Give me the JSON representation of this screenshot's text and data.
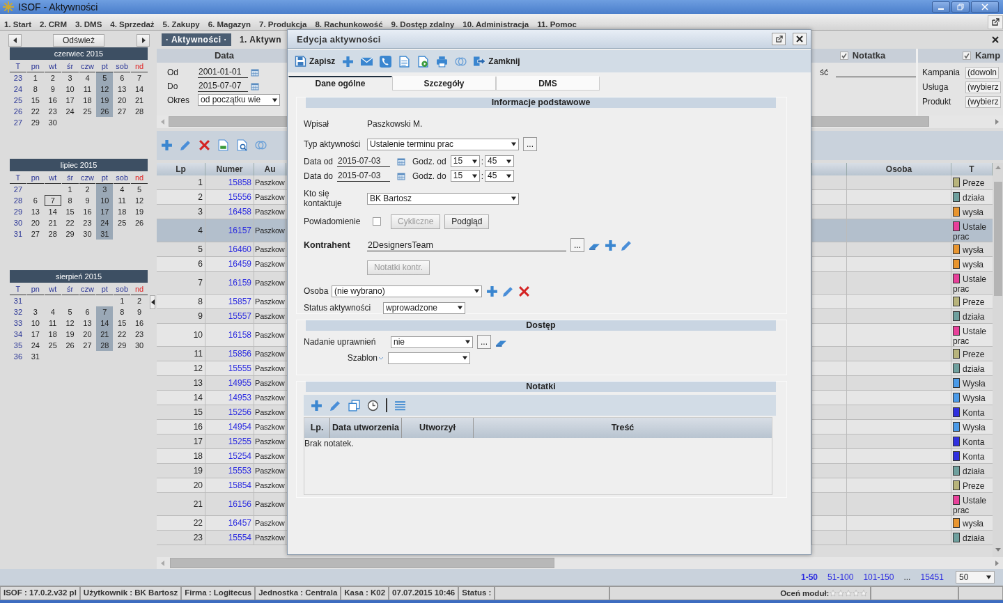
{
  "window": {
    "title": "ISOF - Aktywności"
  },
  "menu": [
    "1. Start",
    "2. CRM",
    "3. DMS",
    "4. Sprzedaż",
    "5. Zakupy",
    "6. Magazyn",
    "7. Produkcja",
    "8. Rachunkowość",
    "9. Dostęp zdalny",
    "10. Administracja",
    "11. Pomoc"
  ],
  "left_panel": {
    "refresh_button": "Odśwież",
    "calendars": [
      {
        "title": "czerwiec 2015",
        "headers": [
          {
            "label": "T",
            "kind": "week",
            "marked": false
          },
          {
            "label": "pn",
            "kind": "day",
            "marked": false
          },
          {
            "label": "wt",
            "kind": "day",
            "marked": false
          },
          {
            "label": "śr",
            "kind": "day",
            "marked": false
          },
          {
            "label": "czw",
            "kind": "day",
            "marked": false
          },
          {
            "label": "pt",
            "kind": "day",
            "marked": true
          },
          {
            "label": "sob",
            "kind": "day",
            "marked": false
          },
          {
            "label": "nd",
            "kind": "holiday",
            "marked": false
          }
        ],
        "weeks": [
          {
            "week": "23",
            "days": [
              "1",
              "2",
              "3",
              "4",
              "5",
              "6",
              "7"
            ]
          },
          {
            "week": "24",
            "days": [
              "8",
              "9",
              "10",
              "11",
              "12",
              "13",
              "14"
            ]
          },
          {
            "week": "25",
            "days": [
              "15",
              "16",
              "17",
              "18",
              "19",
              "20",
              "21"
            ]
          },
          {
            "week": "26",
            "days": [
              "22",
              "23",
              "24",
              "25",
              "26",
              "27",
              "28"
            ]
          },
          {
            "week": "27",
            "days": [
              "29",
              "30"
            ]
          }
        ]
      },
      {
        "title": "lipiec 2015",
        "headers": [
          {
            "label": "T",
            "kind": "week",
            "marked": false
          },
          {
            "label": "pn",
            "kind": "day",
            "marked": false
          },
          {
            "label": "wt",
            "kind": "day",
            "marked": false
          },
          {
            "label": "śr",
            "kind": "day",
            "marked": false
          },
          {
            "label": "czw",
            "kind": "day",
            "marked": false
          },
          {
            "label": "pt",
            "kind": "day",
            "marked": true
          },
          {
            "label": "sob",
            "kind": "day",
            "marked": false
          },
          {
            "label": "nd",
            "kind": "holiday",
            "marked": false
          }
        ],
        "weeks": [
          {
            "week": "27",
            "days": [
              "1",
              "2",
              "3",
              "4",
              "5"
            ]
          },
          {
            "week": "28",
            "days": [
              "6",
              {
                "day": "7",
                "today": true
              },
              "8",
              "9",
              "10",
              "11",
              "12"
            ]
          },
          {
            "week": "29",
            "days": [
              "13",
              "14",
              "15",
              "16",
              "17",
              "18",
              "19"
            ]
          },
          {
            "week": "30",
            "days": [
              "20",
              "21",
              "22",
              "23",
              "24",
              "25",
              "26"
            ]
          },
          {
            "week": "31",
            "days": [
              "27",
              "28",
              "29",
              "30",
              "31"
            ]
          }
        ]
      },
      {
        "title": "sierpień 2015",
        "headers": [
          {
            "label": "T",
            "kind": "week",
            "marked": false
          },
          {
            "label": "pn",
            "kind": "day",
            "marked": false
          },
          {
            "label": "wt",
            "kind": "day",
            "marked": false
          },
          {
            "label": "śr",
            "kind": "day",
            "marked": false
          },
          {
            "label": "czw",
            "kind": "day",
            "marked": false
          },
          {
            "label": "pt",
            "kind": "day",
            "marked": true
          },
          {
            "label": "sob",
            "kind": "day",
            "marked": false
          },
          {
            "label": "nd",
            "kind": "holiday",
            "marked": false
          }
        ],
        "weeks": [
          {
            "week": "31",
            "days": [
              "1",
              "2"
            ]
          },
          {
            "week": "32",
            "days": [
              "3",
              "4",
              "5",
              "6",
              "7",
              "8",
              "9"
            ]
          },
          {
            "week": "33",
            "days": [
              "10",
              "11",
              "12",
              "13",
              "14",
              "15",
              "16"
            ]
          },
          {
            "week": "34",
            "days": [
              "17",
              "18",
              "19",
              "20",
              "21",
              "22",
              "23"
            ]
          },
          {
            "week": "35",
            "days": [
              "24",
              "25",
              "26",
              "27",
              "28",
              "29",
              "30"
            ]
          },
          {
            "week": "36",
            "days": [
              "31"
            ]
          }
        ]
      }
    ]
  },
  "tabs": [
    {
      "label": "· Aktywności ·",
      "selected": true
    },
    {
      "label": "1. Aktywn",
      "selected": false
    }
  ],
  "filters": {
    "data": {
      "title": "Data",
      "from_label": "Od",
      "from": "2001-01-01",
      "to_label": "Do",
      "to": "2015-07-07",
      "period_label": "Okres",
      "period": "od początku wie"
    },
    "notatka": {
      "title": "Notatka",
      "checked": true,
      "field_label": "ść"
    },
    "kampania": {
      "title": "Kamp",
      "checked": true,
      "fields": [
        {
          "label": "Kampania",
          "value": "(dowoln"
        },
        {
          "label": "Usługa",
          "value": "(wybierz"
        },
        {
          "label": "Produkt",
          "value": "(wybierz"
        }
      ]
    }
  },
  "table": {
    "columns": {
      "lp": "Lp",
      "numer": "Numer",
      "au": "Au",
      "osoba": "Osoba",
      "t": "T"
    },
    "rows": [
      {
        "lp": "1",
        "numer": "15858",
        "au": "Paszkow",
        "t": "Preze",
        "color": "#b8b47c",
        "selected": false
      },
      {
        "lp": "2",
        "numer": "15556",
        "au": "Paszkow",
        "t": "działa",
        "color": "#6fa09e",
        "selected": false
      },
      {
        "lp": "3",
        "numer": "16458",
        "au": "Paszkow",
        "t": "wysła",
        "color": "#e8952f",
        "selected": false
      },
      {
        "lp": "4",
        "numer": "16157",
        "au": "Paszkow",
        "t": "Ustale prac",
        "color": "#e8409a",
        "selected": true
      },
      {
        "lp": "5",
        "numer": "16460",
        "au": "Paszkow",
        "t": "wysła",
        "color": "#e8952f",
        "selected": false
      },
      {
        "lp": "6",
        "numer": "16459",
        "au": "Paszkow",
        "t": "wysła",
        "color": "#e8952f",
        "selected": false
      },
      {
        "lp": "7",
        "numer": "16159",
        "au": "Paszkow",
        "t": "Ustale prac",
        "color": "#e8409a",
        "selected": false
      },
      {
        "lp": "8",
        "numer": "15857",
        "au": "Paszkow",
        "t": "Preze",
        "color": "#b8b47c",
        "selected": false
      },
      {
        "lp": "9",
        "numer": "15557",
        "au": "Paszkow",
        "t": "działa",
        "color": "#6fa09e",
        "selected": false
      },
      {
        "lp": "10",
        "numer": "16158",
        "au": "Paszkow",
        "t": "Ustale prac",
        "color": "#e8409a",
        "selected": false
      },
      {
        "lp": "11",
        "numer": "15856",
        "au": "Paszkow",
        "t": "Preze",
        "color": "#b8b47c",
        "selected": false
      },
      {
        "lp": "12",
        "numer": "15555",
        "au": "Paszkow",
        "t": "działa",
        "color": "#6fa09e",
        "selected": false
      },
      {
        "lp": "13",
        "numer": "14955",
        "au": "Paszkow",
        "t": "Wysła",
        "color": "#4a9ae8",
        "selected": false
      },
      {
        "lp": "14",
        "numer": "14953",
        "au": "Paszkow",
        "t": "Wysła",
        "color": "#4a9ae8",
        "selected": false
      },
      {
        "lp": "15",
        "numer": "15256",
        "au": "Paszkow",
        "t": "Konta",
        "color": "#3030e0",
        "selected": false
      },
      {
        "lp": "16",
        "numer": "14954",
        "au": "Paszkow",
        "t": "Wysła",
        "color": "#4a9ae8",
        "selected": false
      },
      {
        "lp": "17",
        "numer": "15255",
        "au": "Paszkow",
        "t": "Konta",
        "color": "#3030e0",
        "selected": false
      },
      {
        "lp": "18",
        "numer": "15254",
        "au": "Paszkow",
        "t": "Konta",
        "color": "#3030e0",
        "selected": false
      },
      {
        "lp": "19",
        "numer": "15553",
        "au": "Paszkow",
        "t": "działa",
        "color": "#6fa09e",
        "selected": false
      },
      {
        "lp": "20",
        "numer": "15854",
        "au": "Paszkow",
        "t": "Preze",
        "color": "#b8b47c",
        "selected": false
      },
      {
        "lp": "21",
        "numer": "16156",
        "au": "Paszkow",
        "t": "Ustale prac",
        "color": "#e8409a",
        "selected": false
      },
      {
        "lp": "22",
        "numer": "16457",
        "au": "Paszkow",
        "t": "wysła",
        "color": "#e8952f",
        "selected": false
      },
      {
        "lp": "23",
        "numer": "15554",
        "au": "Paszkow",
        "t": "działa",
        "color": "#6fa09e",
        "selected": false
      }
    ]
  },
  "pager": {
    "pages": [
      {
        "label": "1-50",
        "selected": true
      },
      {
        "label": "51-100",
        "selected": false
      },
      {
        "label": "101-150",
        "selected": false
      }
    ],
    "ellipsis": "...",
    "last_page": {
      "label": "15451",
      "selected": false
    },
    "page_size": "50"
  },
  "status_bar": {
    "cells": [
      "ISOF : 17.0.2.v32 pl",
      "Użytkownik : BK Bartosz",
      "Firma : Logitecus",
      "Jednostka : Centrala",
      "Kasa : K02",
      "07.07.2015 10:46",
      "Status :"
    ],
    "rating": {
      "label": "Oceń moduł:",
      "stars": 0
    }
  },
  "dialog": {
    "title": "Edycja aktywności",
    "save": "Zapisz",
    "close": "Zamknij",
    "tabs": [
      {
        "label": "Dane ogólne",
        "selected": true
      },
      {
        "label": "Szczegóły",
        "selected": false
      },
      {
        "label": "DMS",
        "selected": false
      }
    ],
    "basic": {
      "title": "Informacje podstawowe",
      "author_label": "Wpisał",
      "author": "Paszkowski M.",
      "type_label": "Typ aktywności",
      "type": "Ustalenie terminu prac",
      "type_browse": "...",
      "date_from": {
        "label": "Data od",
        "date": "2015-07-03",
        "time_label": "Godz. od",
        "hour": "15",
        "sep": ":",
        "minute": "45"
      },
      "date_to": {
        "label": "Data do",
        "date": "2015-07-03",
        "time_label": "Godz. do",
        "hour": "15",
        "sep": ":",
        "minute": "45"
      },
      "contact_label": "Kto się kontaktuje",
      "contact": "BK Bartosz",
      "notify_label": "Powiadomienie",
      "notify_checked": false,
      "cyclic": {
        "label": "Cykliczne",
        "disabled": true
      },
      "preview": {
        "label": "Podgląd",
        "disabled": false
      },
      "contractor_label": "Kontrahent",
      "contractor": "2DesignersTeam",
      "contractor_browse": "...",
      "contractor_notes": {
        "label": "Notatki kontr.",
        "disabled": true
      },
      "person_label": "Osoba",
      "person": "(nie wybrano)",
      "status_label": "Status aktywności",
      "status": "wprowadzone"
    },
    "access": {
      "title": "Dostęp",
      "rights_label": "Nadanie uprawnień",
      "rights": "nie",
      "browse": "...",
      "template_label": "Szablon"
    },
    "notes": {
      "title": "Notatki",
      "columns": [
        "Lp.",
        "Data utworzenia",
        "Utworzył",
        "Treść"
      ],
      "empty": "Brak notatek."
    }
  }
}
